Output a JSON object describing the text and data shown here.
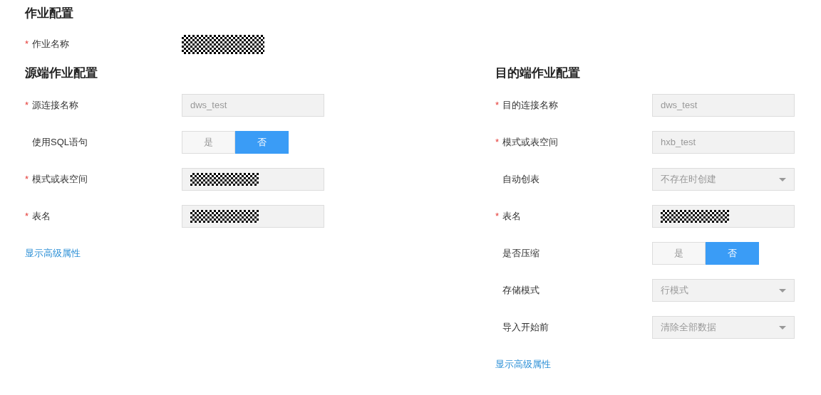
{
  "job": {
    "title": "作业配置",
    "fields": [
      {
        "label": "作业名称",
        "required_mark": "*",
        "kind": "masked"
      }
    ]
  },
  "source": {
    "title": "源端作业配置",
    "fields": [
      {
        "label": "源连接名称",
        "required_mark": "*",
        "kind": "text",
        "redacted": false,
        "value": "dws_test"
      },
      {
        "label": "使用SQL语句",
        "kind": "toggle",
        "options": [
          {
            "label": "是",
            "selected": false
          },
          {
            "label": "否",
            "selected": true
          }
        ]
      },
      {
        "label": "模式或表空间",
        "required_mark": "*",
        "kind": "text",
        "redacted": true
      },
      {
        "label": "表名",
        "required_mark": "*",
        "kind": "text",
        "redacted": true
      }
    ],
    "link": "显示高级属性"
  },
  "target": {
    "title": "目的端作业配置",
    "fields": [
      {
        "label": "目的连接名称",
        "required_mark": "*",
        "kind": "text",
        "redacted": false,
        "value": "dws_test"
      },
      {
        "label": "模式或表空间",
        "required_mark": "*",
        "kind": "text",
        "redacted": false,
        "value": "hxb_test"
      },
      {
        "label": "自动创表",
        "kind": "select",
        "value": "不存在时创建"
      },
      {
        "label": "表名",
        "required_mark": "*",
        "kind": "text",
        "redacted": true
      },
      {
        "label": "是否压缩",
        "kind": "toggle",
        "options": [
          {
            "label": "是",
            "selected": false
          },
          {
            "label": "否",
            "selected": true
          }
        ]
      },
      {
        "label": "存储模式",
        "kind": "select",
        "value": "行模式"
      },
      {
        "label": "导入开始前",
        "kind": "select",
        "value": "清除全部数据"
      }
    ],
    "link": "显示高级属性"
  }
}
